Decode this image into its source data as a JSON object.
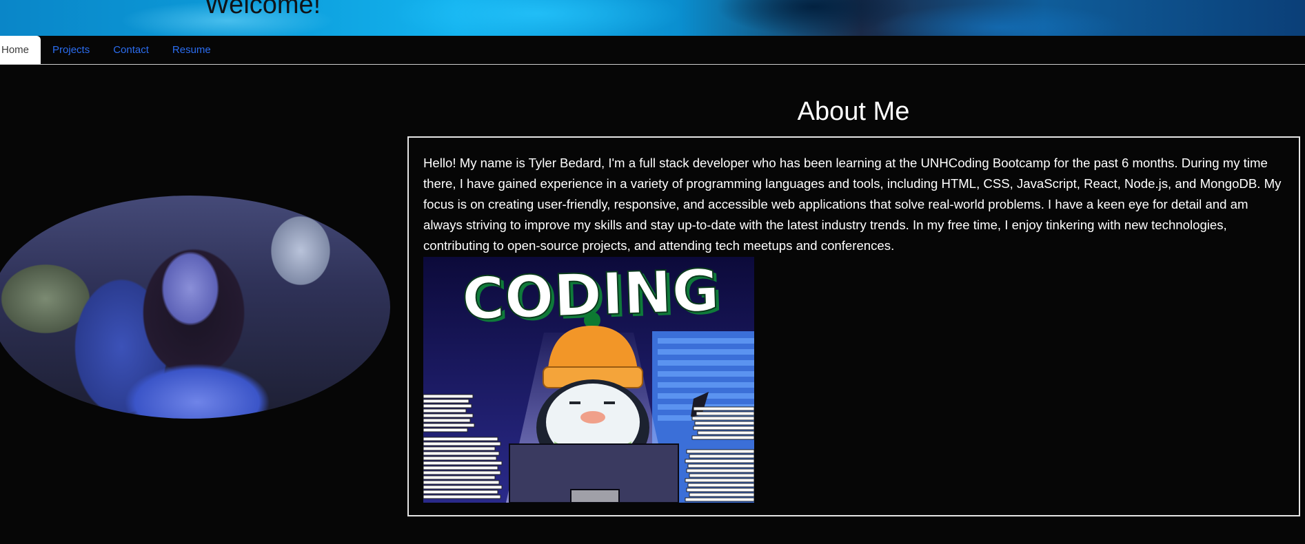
{
  "header": {
    "title": "Welcome!"
  },
  "nav": {
    "items": [
      {
        "label": "Home",
        "active": true
      },
      {
        "label": "Projects",
        "active": false
      },
      {
        "label": "Contact",
        "active": false
      },
      {
        "label": "Resume",
        "active": false
      }
    ]
  },
  "about": {
    "heading": "About Me",
    "paragraph": "Hello! My name is Tyler Bedard, I'm a full stack developer who has been learning at the UNHCoding Bootcamp for the past 6 months. During my time there, I have gained experience in a variety of programming languages and tools, including HTML, CSS, JavaScript, React, Node.js, and MongoDB. My focus is on creating user-friendly, responsive, and accessible web applications that solve real-world problems. I have a keen eye for detail and am always striving to improve my skills and stay up-to-date with the latest industry trends. In my free time, I enjoy tinkering with new technologies, contributing to open-source projects, and attending tech meetups and conferences.",
    "image_caption_text": "CODING"
  },
  "colors": {
    "background": "#060606",
    "nav_link": "#2b6df0",
    "banner": "#0c9ad8"
  }
}
